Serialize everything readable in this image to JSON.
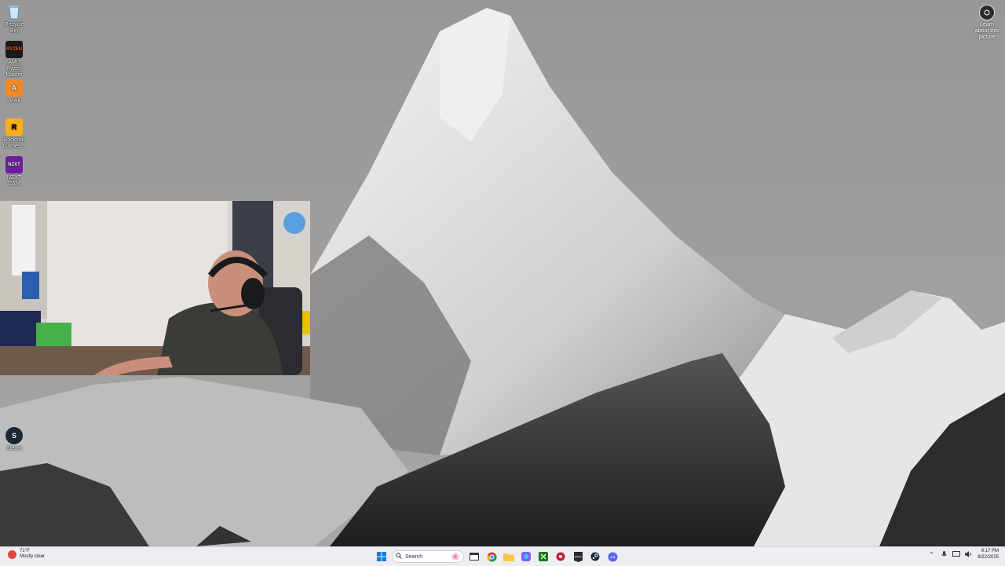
{
  "desktop": {
    "icons": [
      {
        "label": "Recycle Bin",
        "icon": "recycle-bin-icon"
      },
      {
        "label": "AMD Ryzen Master",
        "icon": "ryzen-master-icon"
      },
      {
        "label": "Anvil",
        "icon": "anvil-icon"
      },
      {
        "label": "Rockstar Games...",
        "icon": "rockstar-icon"
      },
      {
        "label": "NZXT CAM",
        "icon": "nzxt-icon"
      },
      {
        "label": "Steam",
        "icon": "steam-icon"
      }
    ],
    "learn_label": "Learn about this picture"
  },
  "taskbar": {
    "weather_temp": "71°F",
    "weather_desc": "Mostly clear",
    "search_placeholder": "Search",
    "pinned": [
      "start-icon",
      "search-icon",
      "cortana-icon",
      "file-explorer-icon",
      "chrome-icon",
      "folder-icon",
      "photos-icon",
      "xbox-icon",
      "app-red-icon",
      "epic-games-icon",
      "steam-icon",
      "discord-icon"
    ],
    "clock_time": "9:17 PM",
    "clock_date": "8/22/2025"
  },
  "colors": {
    "taskbar_bg": "#eceef2",
    "accent": "#0067c0"
  }
}
